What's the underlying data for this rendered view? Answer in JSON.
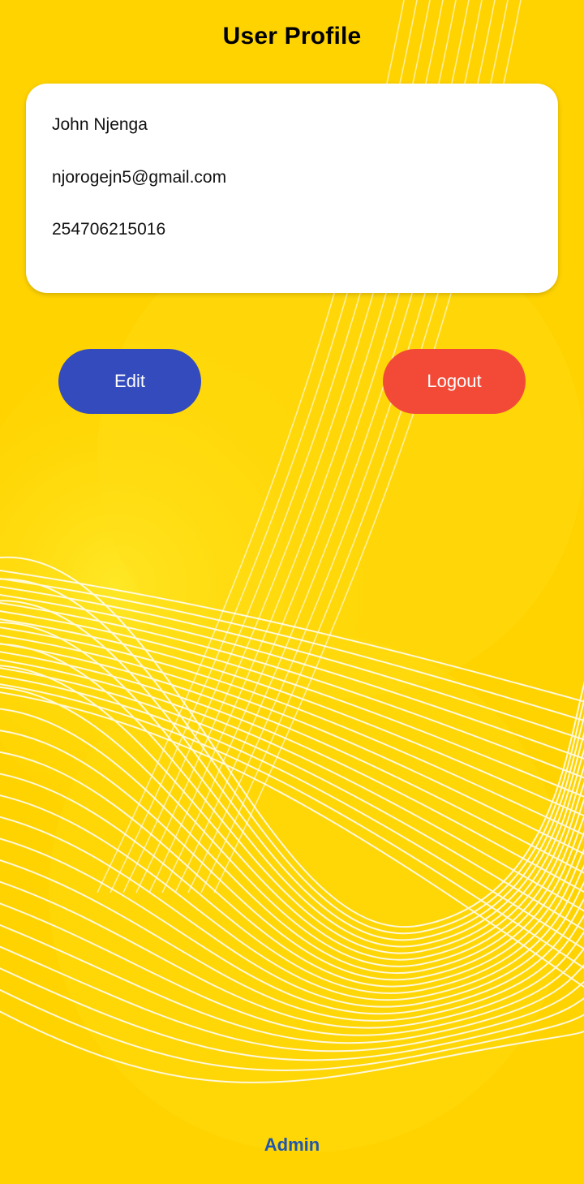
{
  "header": {
    "title": "User Profile"
  },
  "profile": {
    "name": "John Njenga",
    "email": "njorogejn5@gmail.com",
    "phone": "254706215016"
  },
  "actions": {
    "edit_label": "Edit",
    "logout_label": "Logout"
  },
  "footer": {
    "admin_link": "Admin"
  },
  "colors": {
    "background": "#FFD000",
    "edit_button": "#344BBD",
    "logout_button": "#F34A38",
    "admin_link": "#1D55B0"
  }
}
